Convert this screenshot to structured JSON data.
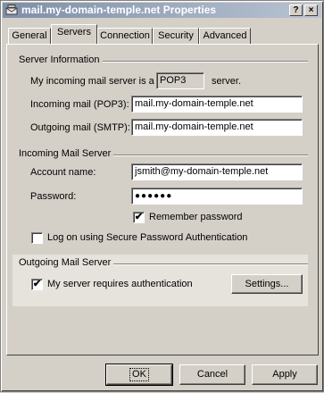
{
  "window": {
    "title": "mail.my-domain-temple.net Properties",
    "help_label": "?",
    "close_label": "×"
  },
  "tabs": [
    {
      "label": "General",
      "active": false
    },
    {
      "label": "Servers",
      "active": true
    },
    {
      "label": "Connection",
      "active": false
    },
    {
      "label": "Security",
      "active": false
    },
    {
      "label": "Advanced",
      "active": false
    }
  ],
  "server_information": {
    "heading": "Server Information",
    "incoming_prefix": "My incoming mail server is a",
    "server_type": "POP3",
    "incoming_suffix": "server.",
    "incoming_label": "Incoming mail (POP3):",
    "incoming_value": "mail.my-domain-temple.net",
    "outgoing_label": "Outgoing mail (SMTP):",
    "outgoing_value": "mail.my-domain-temple.net"
  },
  "incoming_mail_server": {
    "heading": "Incoming Mail Server",
    "account_label": "Account name:",
    "account_value": "jsmith@my-domain-temple.net",
    "password_label": "Password:",
    "password_value": "●●●●●●",
    "remember_label": "Remember password",
    "remember_checked": true,
    "spa_label": "Log on using Secure Password Authentication",
    "spa_checked": false
  },
  "outgoing_mail_server": {
    "heading": "Outgoing Mail Server",
    "auth_label": "My server requires authentication",
    "auth_checked": true,
    "settings_label": "Settings..."
  },
  "buttons": {
    "ok": "OK",
    "cancel": "Cancel",
    "apply": "Apply"
  },
  "check_mark": "✔"
}
